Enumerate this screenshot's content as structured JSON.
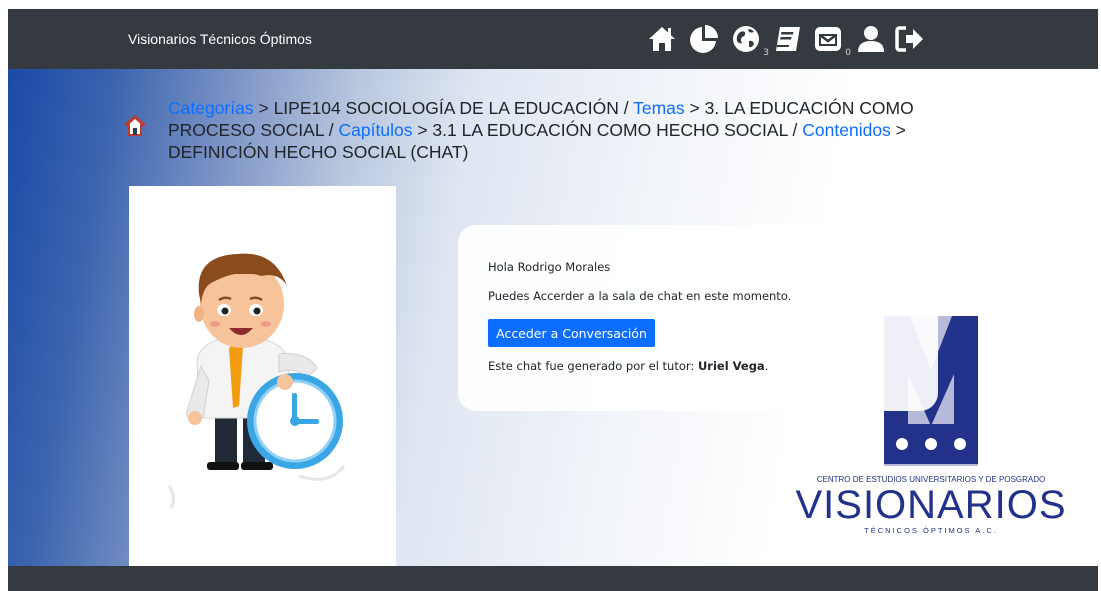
{
  "navbar": {
    "brand": "Visionarios Técnicos Óptimos",
    "icons": [
      {
        "name": "home-icon"
      },
      {
        "name": "pie-chart-icon"
      },
      {
        "name": "globe-icon",
        "badge": "3"
      },
      {
        "name": "book-icon"
      },
      {
        "name": "envelope-icon",
        "badge": "0"
      },
      {
        "name": "user-icon"
      },
      {
        "name": "sign-out-icon"
      }
    ]
  },
  "breadcrumb": {
    "categories_link": "Categorías",
    "sep1": " > ",
    "course": "LIPE104 SOCIOLOGÍA DE LA EDUCACIÓN",
    "slash1": " / ",
    "themes_link": "Temas",
    "sep2": " > ",
    "theme": "3. LA EDUCACIÓN COMO PROCESO SOCIAL",
    "slash2": " / ",
    "chapters_link": "Capítulos",
    "sep3": " > ",
    "chapter": "3.1 LA EDUCACIÓN COMO HECHO SOCIAL",
    "slash3": " / ",
    "contents_link": "Contenidos",
    "sep4": " > ",
    "content": "DEFINICIÓN HECHO SOCIAL (CHAT)"
  },
  "chat": {
    "greeting": "Hola Rodrigo Morales",
    "available": "Puedes Accerder a la sala de chat en este momento.",
    "button_label": "Acceder a Conversación",
    "tutor_prefix": "Este chat fue generado por el tutor: ",
    "tutor_name": "Uriel Vega",
    "tutor_suffix": "."
  },
  "logo": {
    "subtitle": "CENTRO DE ESTUDIOS UNIVERSITARIOS Y DE POSGRADO",
    "name": "VISIONARIOS",
    "tagline": "TÉCNICOS ÓPTIMOS A.C."
  },
  "colors": {
    "navbar": "#343a40",
    "link": "#0d6efd",
    "button": "#0d6efd",
    "logo_navy": "#22318a",
    "logo_lavender": "#b7b9d8"
  }
}
